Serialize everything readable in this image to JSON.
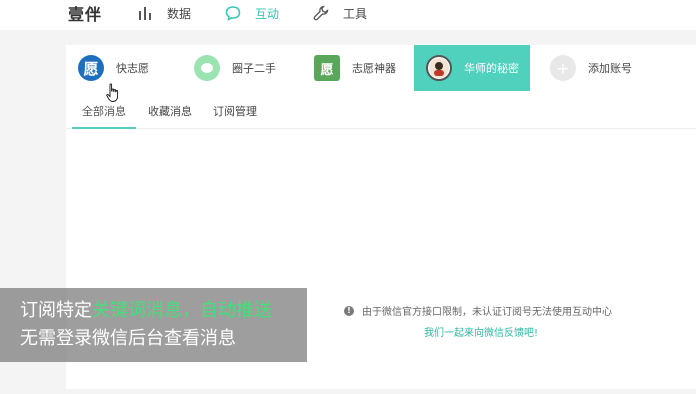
{
  "topnav": {
    "logo": "壹伴",
    "items": [
      {
        "label": "数据",
        "icon": "bar-chart-icon",
        "active": false
      },
      {
        "label": "互动",
        "icon": "chat-bubble-icon",
        "active": true
      },
      {
        "label": "工具",
        "icon": "wrench-icon",
        "active": false
      }
    ]
  },
  "accounts": [
    {
      "name": "快志愿",
      "avatar_char": "愿",
      "active": false
    },
    {
      "name": "圈子二手",
      "avatar_char": "",
      "active": false
    },
    {
      "name": "志愿神器",
      "avatar_char": "愿",
      "active": false
    },
    {
      "name": "华师的秘密",
      "avatar_char": "",
      "active": true
    },
    {
      "name": "添加账号",
      "avatar_char": "+",
      "active": false
    }
  ],
  "tabs": [
    {
      "label": "全部消息",
      "active": true
    },
    {
      "label": "收藏消息",
      "active": false
    },
    {
      "label": "订阅管理",
      "active": false
    }
  ],
  "notice": {
    "text": "由于微信官方接口限制，未认证订阅号无法使用互动中心",
    "feedback_link": "我们一起来向微信反馈吧!"
  },
  "banner": {
    "line1_prefix": "订阅特定",
    "line1_highlight": "关键词消息，自动推送",
    "line2": "无需登录微信后台查看消息"
  },
  "colors": {
    "accent": "#4fd1be",
    "highlight": "#43e07a"
  }
}
